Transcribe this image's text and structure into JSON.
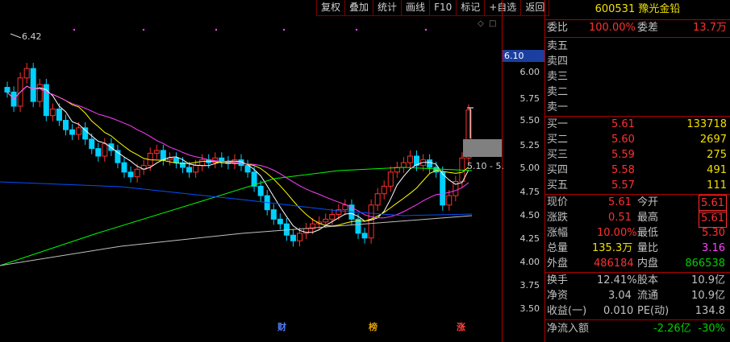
{
  "toolbar": {
    "buttons": [
      "复权",
      "叠加",
      "统计",
      "画线",
      "F10",
      "标记",
      "+自选",
      "返回"
    ]
  },
  "chart": {
    "high_label": "6.42",
    "range_label": "5.10 - 5.",
    "axis_labels": [
      "6.00",
      "5.75",
      "5.50",
      "5.25",
      "5.00",
      "4.75",
      "4.50",
      "4.25",
      "4.00",
      "3.75",
      "3.50"
    ],
    "axis_current": "6.10",
    "markers": [
      {
        "text": "财",
        "color": "#4f7fff"
      },
      {
        "text": "榜",
        "color": "#e0a000"
      },
      {
        "text": "涨",
        "color": "#ff4040"
      }
    ]
  },
  "stock": {
    "code": "600531",
    "name": "豫光金铅"
  },
  "order_ratio": {
    "label": "委比",
    "value": "100.00%",
    "diff_label": "委差",
    "diff_value": "13.7万"
  },
  "asks": [
    {
      "label": "卖五",
      "price": "",
      "vol": ""
    },
    {
      "label": "卖四",
      "price": "",
      "vol": ""
    },
    {
      "label": "卖三",
      "price": "",
      "vol": ""
    },
    {
      "label": "卖二",
      "price": "",
      "vol": ""
    },
    {
      "label": "卖一",
      "price": "",
      "vol": ""
    }
  ],
  "bids": [
    {
      "label": "买一",
      "price": "5.61",
      "vol": "133718"
    },
    {
      "label": "买二",
      "price": "5.60",
      "vol": "2697"
    },
    {
      "label": "买三",
      "price": "5.59",
      "vol": "275"
    },
    {
      "label": "买四",
      "price": "5.58",
      "vol": "491"
    },
    {
      "label": "买五",
      "price": "5.57",
      "vol": "111"
    }
  ],
  "quote": {
    "r1": {
      "l1": "现价",
      "v1": "5.61",
      "l2": "今开",
      "v2": "5.61"
    },
    "r2": {
      "l1": "涨跌",
      "v1": "0.51",
      "l2": "最高",
      "v2": "5.61"
    },
    "r3": {
      "l1": "涨幅",
      "v1": "10.00%",
      "l2": "最低",
      "v2": "5.30"
    },
    "r4": {
      "l1": "总量",
      "v1": "135.3万",
      "l2": "量比",
      "v2": "3.16"
    },
    "r5": {
      "l1": "外盘",
      "v1": "486184",
      "l2": "内盘",
      "v2": "866538"
    }
  },
  "fund": {
    "r1": {
      "l1": "换手",
      "v1": "12.41%",
      "l2": "股本",
      "v2": "10.9亿"
    },
    "r2": {
      "l1": "净资",
      "v1": "3.04",
      "l2": "流通",
      "v2": "10.9亿"
    },
    "r3": {
      "l1": "收益(一)",
      "v1": "0.010",
      "l2": "PE(动)",
      "v2": "134.8"
    }
  },
  "flow": {
    "label": "净流入额",
    "value": "-2.26亿",
    "pct": "-30%"
  },
  "colors": {
    "up": "#ff3030",
    "down": "#00d0ff",
    "ma5": "#ffffff",
    "ma10": "#ffff00",
    "ma20": "#ff40ff",
    "ma60": "#00ff00",
    "ma120": "#0050ff",
    "ma250": "#c0c0c0"
  }
}
